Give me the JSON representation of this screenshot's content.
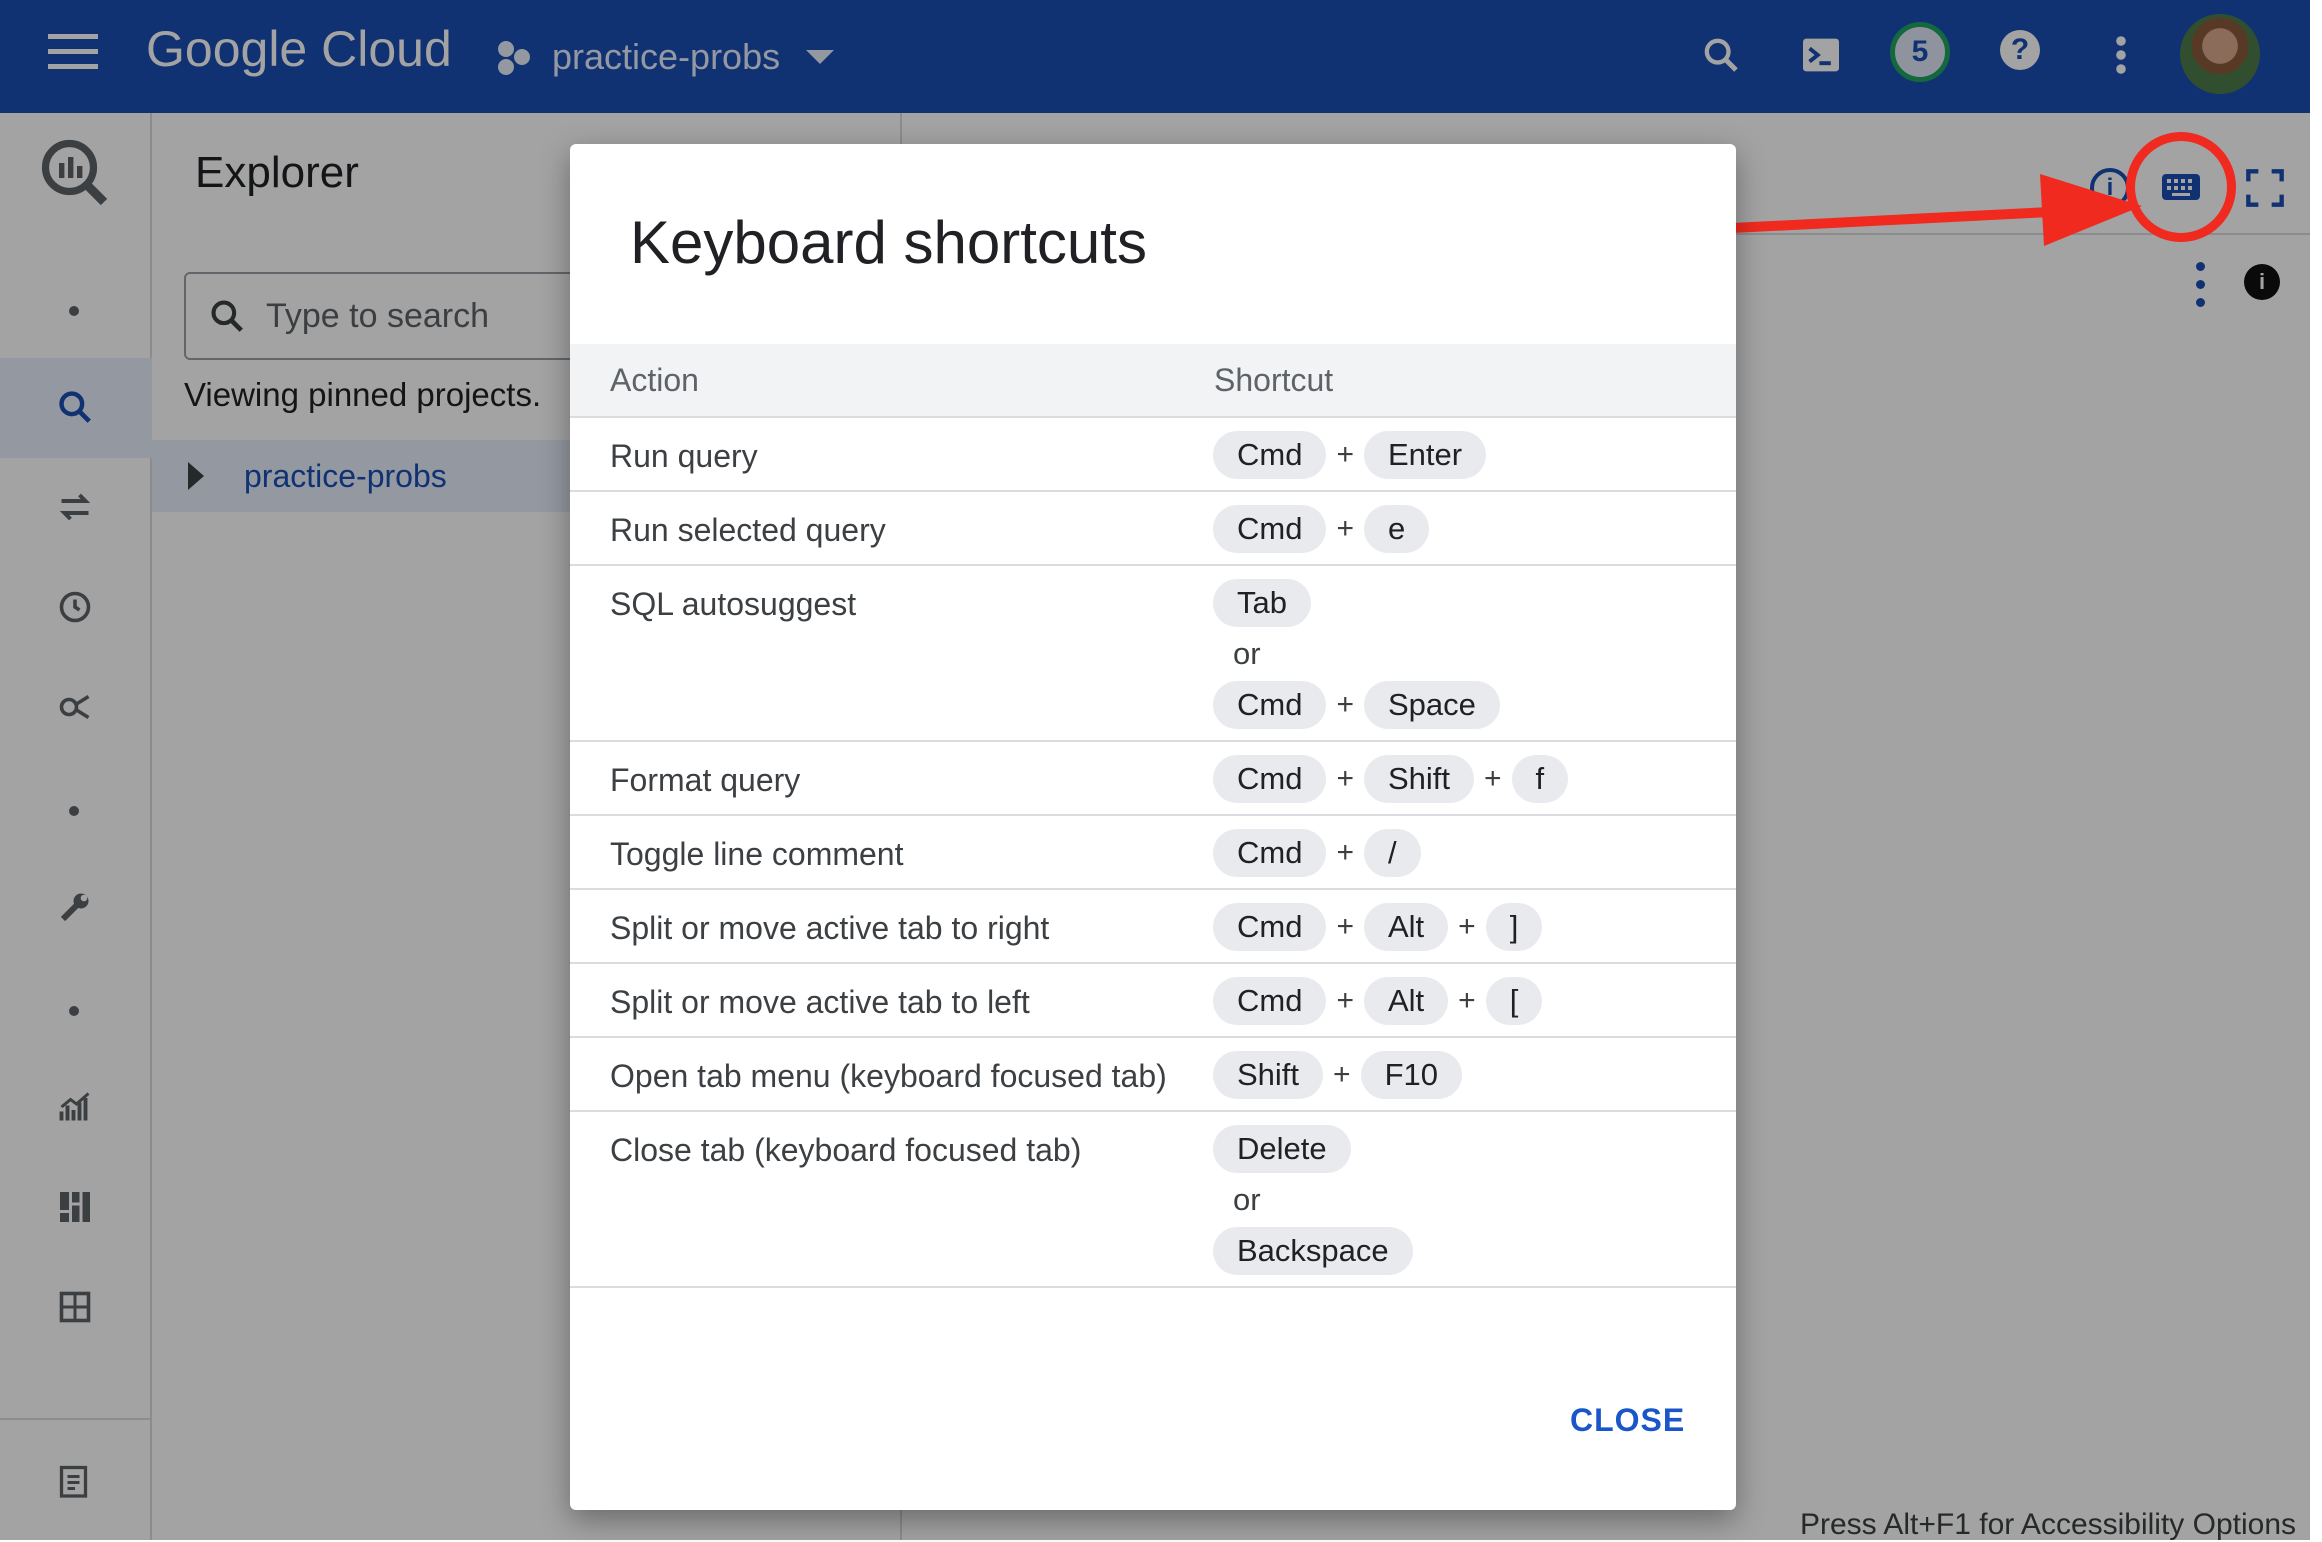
{
  "topbar": {
    "logo": "Google Cloud",
    "project": "practice-probs",
    "notifications_count": "5",
    "help_glyph": "?"
  },
  "explorer": {
    "title": "Explorer",
    "search_placeholder": "Type to search",
    "pinned_text": "Viewing pinned projects.",
    "project_node": "practice-probs"
  },
  "status_bar": "Press Alt+F1 for Accessibility Options",
  "icons": {
    "info": "i"
  },
  "dialog": {
    "title": "Keyboard shortcuts",
    "headers": [
      "Action",
      "Shortcut"
    ],
    "or_text": "or",
    "close_label": "CLOSE",
    "rows": [
      {
        "action": "Run query",
        "k1": "Cmd",
        "k2": "Enter"
      },
      {
        "action": "Run selected query",
        "k1": "Cmd",
        "k2": "e"
      },
      {
        "action": "SQL autosuggest",
        "k1": "Tab",
        "k2": "Cmd",
        "k3": "Space"
      },
      {
        "action": "Format query",
        "k1": "Cmd",
        "k2": "Shift",
        "k3": "f"
      },
      {
        "action": "Toggle line comment",
        "k1": "Cmd",
        "k2": "/"
      },
      {
        "action": "Split or move active tab to right",
        "k1": "Cmd",
        "k2": "Alt",
        "k3": "]"
      },
      {
        "action": "Split or move active tab to left",
        "k1": "Cmd",
        "k2": "Alt",
        "k3": "["
      },
      {
        "action": "Open tab menu (keyboard focused tab)",
        "k1": "Shift",
        "k2": "F10"
      },
      {
        "action": "Close tab (keyboard focused tab)",
        "k1": "Delete",
        "k2": "Backspace"
      }
    ]
  },
  "colors": {
    "topbar": "#1a4fb5",
    "annotation_red": "#f02a1e",
    "link_blue": "#1a56c9"
  }
}
